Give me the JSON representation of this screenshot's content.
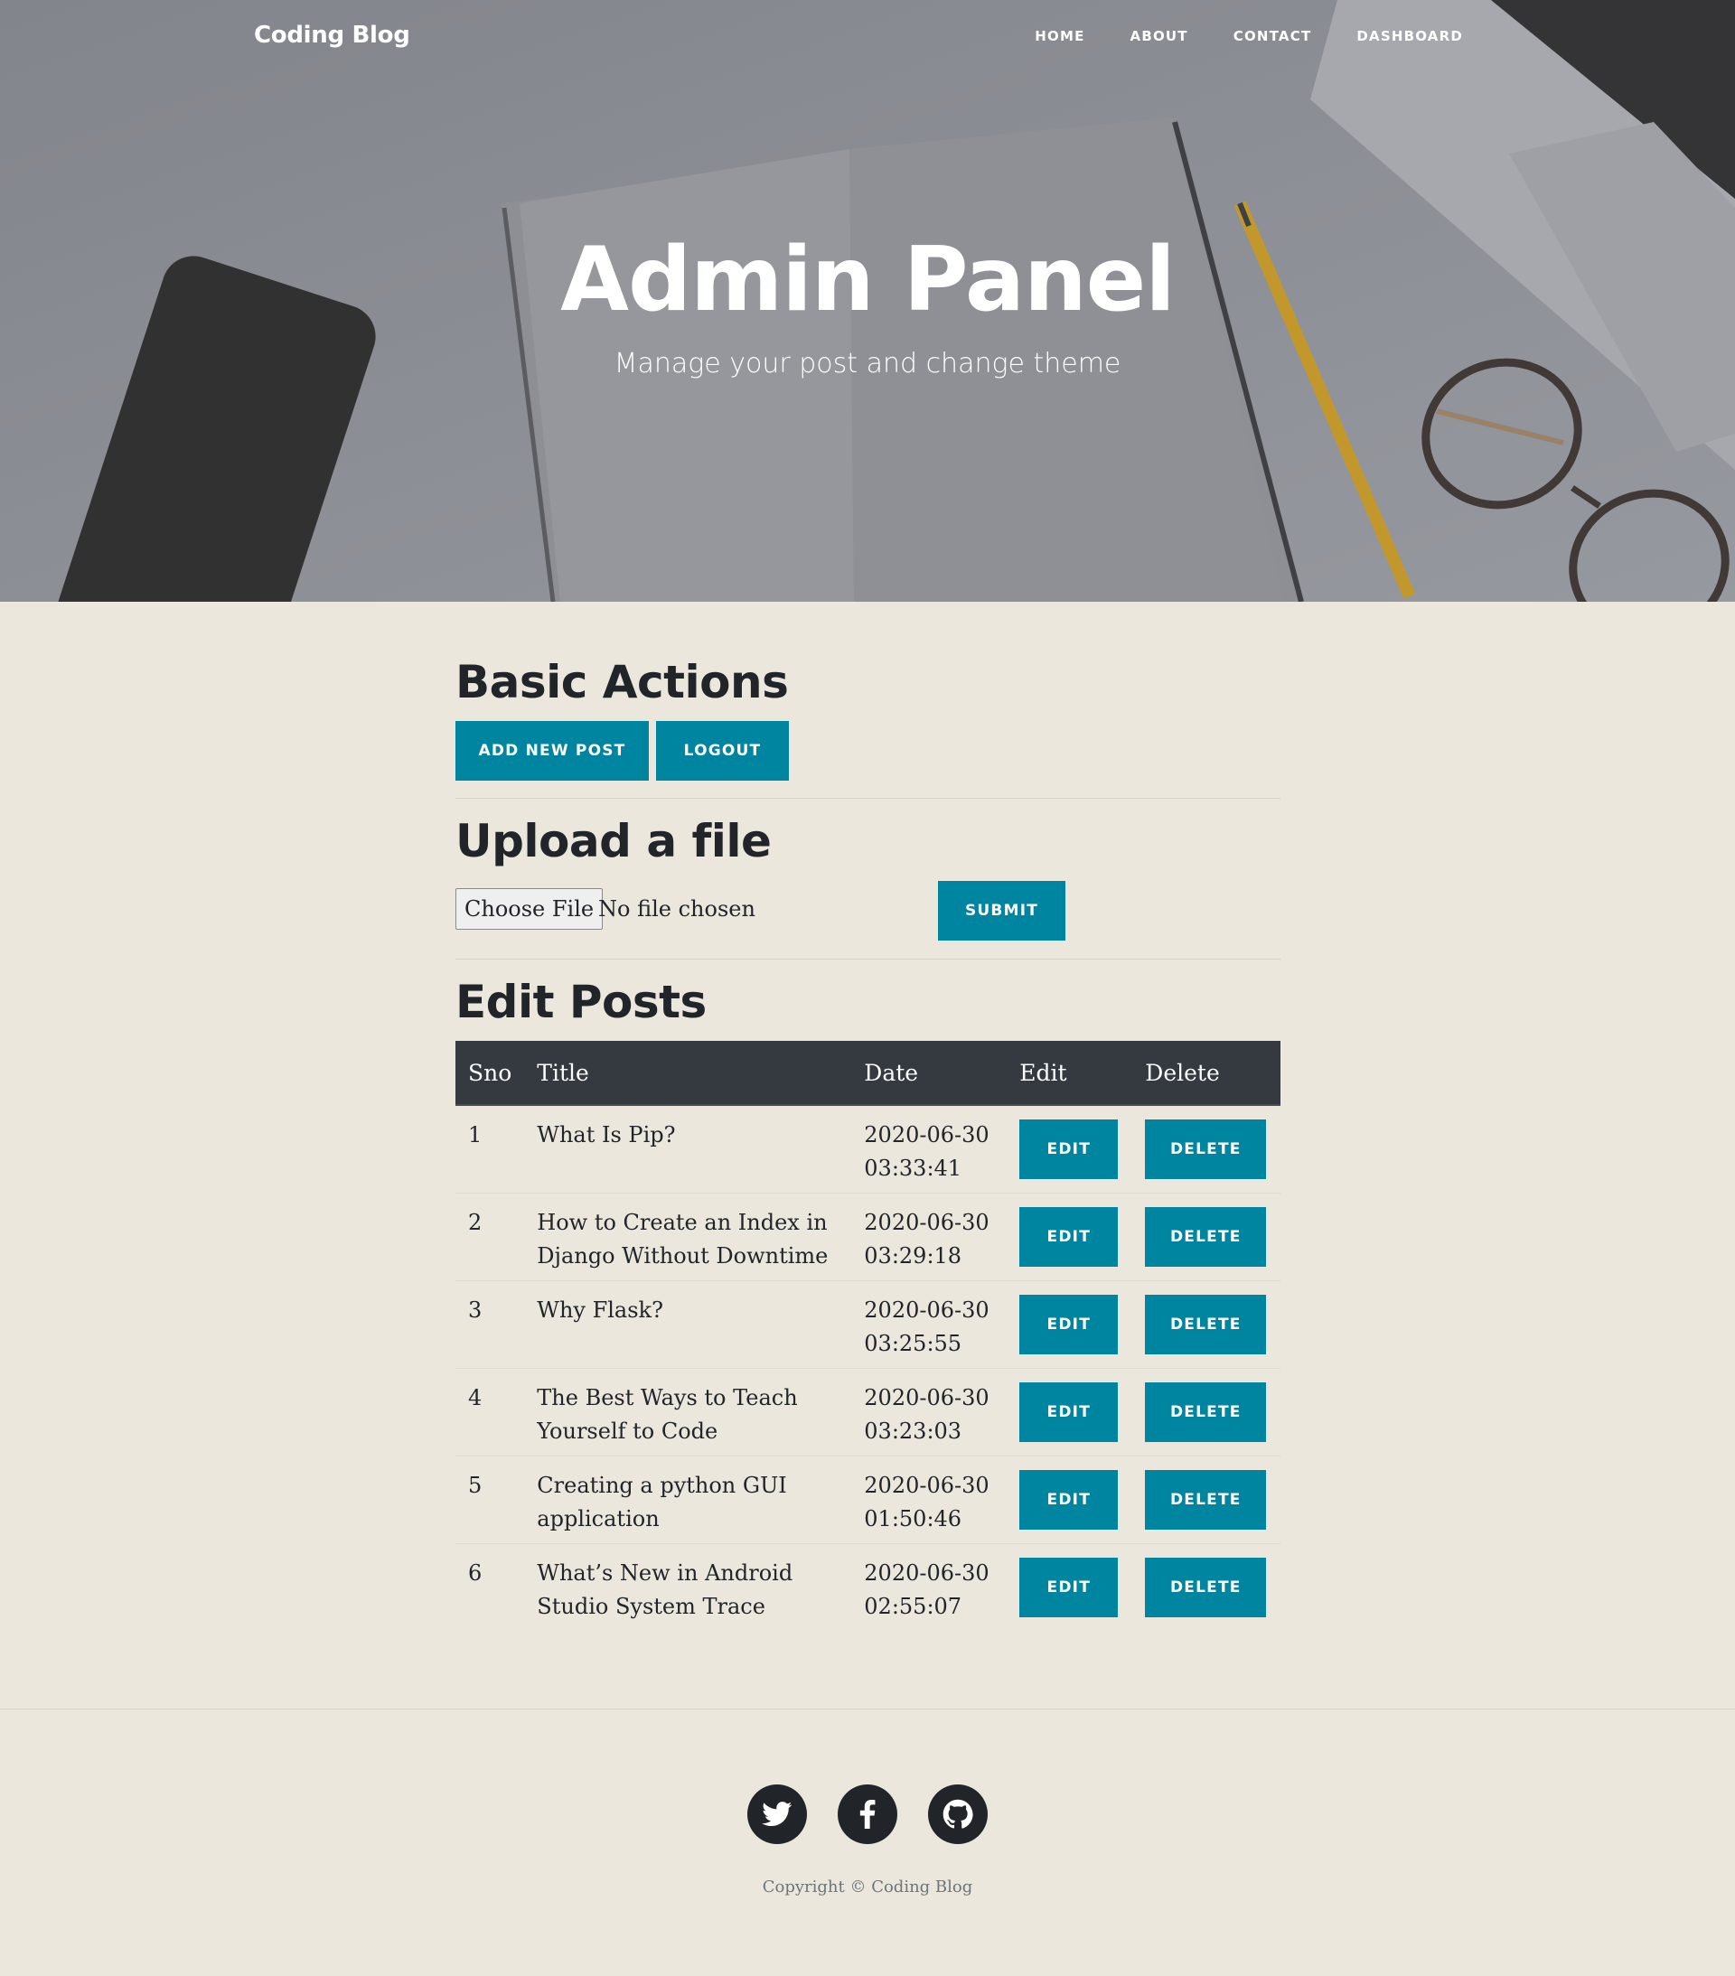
{
  "nav": {
    "brand": "Coding Blog",
    "links": [
      "Home",
      "About",
      "Contact",
      "Dashboard"
    ]
  },
  "hero": {
    "title": "Admin Panel",
    "subtitle": "Manage your post and change theme"
  },
  "basic_actions": {
    "title": "Basic Actions",
    "add_post_label": "Add new post",
    "logout_label": "Logout"
  },
  "upload": {
    "title": "Upload a file",
    "choose_label": "Choose File",
    "status_text": "No file chosen",
    "submit_label": "Submit"
  },
  "edit_posts": {
    "title": "Edit Posts",
    "columns": [
      "Sno",
      "Title",
      "Date",
      "Edit",
      "Delete"
    ],
    "edit_label": "Edit",
    "delete_label": "Delete",
    "rows": [
      {
        "sno": "1",
        "title": "What Is Pip?",
        "date": "2020-06-30",
        "time": "03:33:41"
      },
      {
        "sno": "2",
        "title": "How to Create an Index in Django Without Downtime",
        "date": "2020-06-30",
        "time": "03:29:18"
      },
      {
        "sno": "3",
        "title": "Why Flask?",
        "date": "2020-06-30",
        "time": "03:25:55"
      },
      {
        "sno": "4",
        "title": "The Best Ways to Teach Yourself to Code",
        "date": "2020-06-30",
        "time": "03:23:03"
      },
      {
        "sno": "5",
        "title": "Creating a python GUI application",
        "date": "2020-06-30",
        "time": "01:50:46"
      },
      {
        "sno": "6",
        "title": "What’s New in Android Studio System Trace",
        "date": "2020-06-30",
        "time": "02:55:07"
      }
    ]
  },
  "footer": {
    "social_icons": [
      "twitter-icon",
      "facebook-icon",
      "github-icon"
    ],
    "copyright": "Copyright © Coding Blog"
  },
  "colors": {
    "accent": "#0085a1",
    "page_bg": "#ebe7dd",
    "table_header": "#343a40",
    "text": "#212529"
  }
}
